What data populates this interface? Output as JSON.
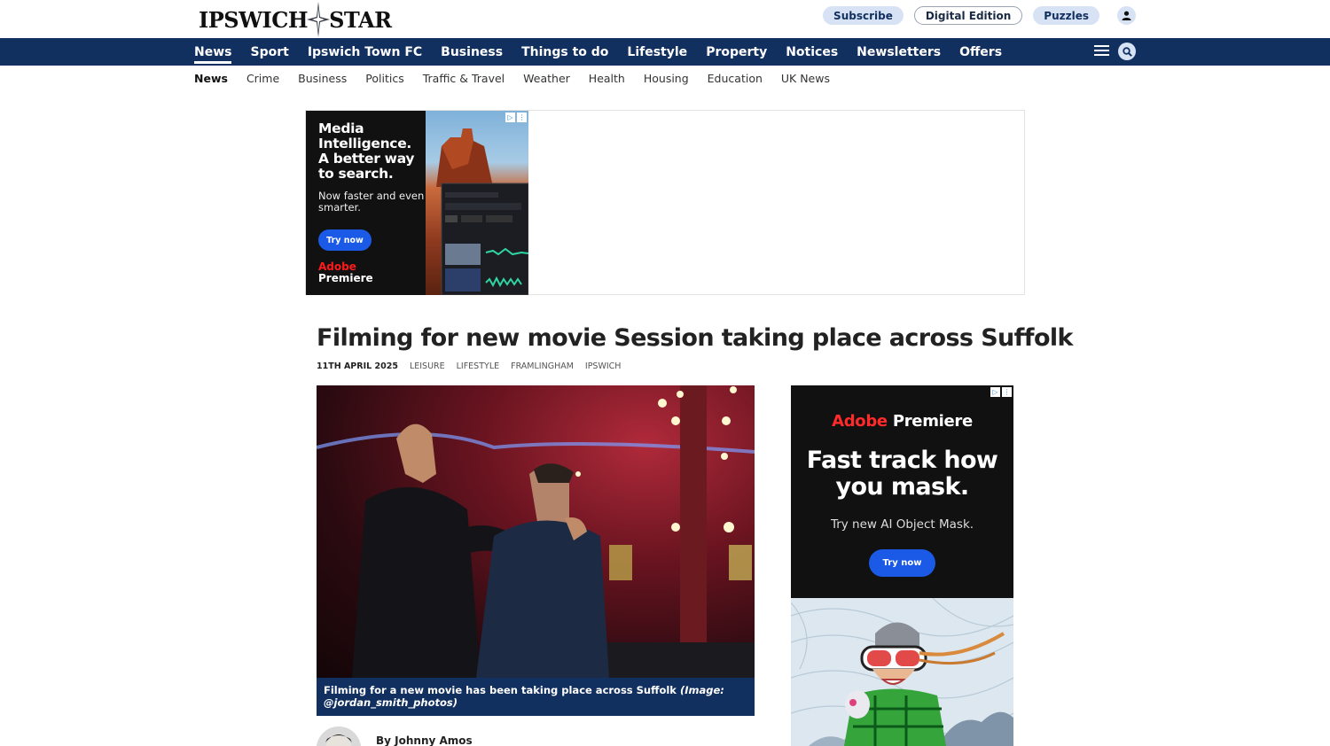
{
  "site": {
    "logo_left": "IPSWICH",
    "logo_right": "STAR"
  },
  "header": {
    "subscribe": "Subscribe",
    "digital_edition": "Digital Edition",
    "puzzles": "Puzzles"
  },
  "main_nav": [
    {
      "label": "News",
      "active": true
    },
    {
      "label": "Sport"
    },
    {
      "label": "Ipswich Town FC"
    },
    {
      "label": "Business"
    },
    {
      "label": "Things to do"
    },
    {
      "label": "Lifestyle"
    },
    {
      "label": "Property"
    },
    {
      "label": "Notices"
    },
    {
      "label": "Newsletters"
    },
    {
      "label": "Offers"
    }
  ],
  "sub_nav": [
    {
      "label": "News",
      "active": true
    },
    {
      "label": "Crime"
    },
    {
      "label": "Business"
    },
    {
      "label": "Politics"
    },
    {
      "label": "Traffic & Travel"
    },
    {
      "label": "Weather"
    },
    {
      "label": "Health"
    },
    {
      "label": "Housing"
    },
    {
      "label": "Education"
    },
    {
      "label": "UK News"
    }
  ],
  "top_ad": {
    "headline": "Media Intelligence. A better way to search.",
    "sub": "Now faster and even smarter.",
    "cta": "Try now",
    "brand_red": "Adobe",
    "brand_white": "Premiere"
  },
  "article": {
    "title": "Filming for new movie Session taking place across Suffolk",
    "date": "11TH APRIL 2025",
    "tags": [
      "LEISURE",
      "LIFESTYLE",
      "FRAMLINGHAM",
      "IPSWICH"
    ],
    "caption": "Filming for a new movie has been taking place across Suffolk",
    "caption_credit": "(Image: @jordan_smith_photos)",
    "byline": "By Johnny Amos"
  },
  "side_ad": {
    "brand_red": "Adobe",
    "brand_white": "Premiere",
    "headline": "Fast track how you mask.",
    "sub": "Try new AI Object Mask.",
    "cta": "Try now"
  },
  "colors": {
    "nav_bg": "#12305f",
    "pill_bg": "#d7e3f5",
    "cta_blue": "#1b5ae6",
    "adobe_red": "#ff1a1a"
  }
}
